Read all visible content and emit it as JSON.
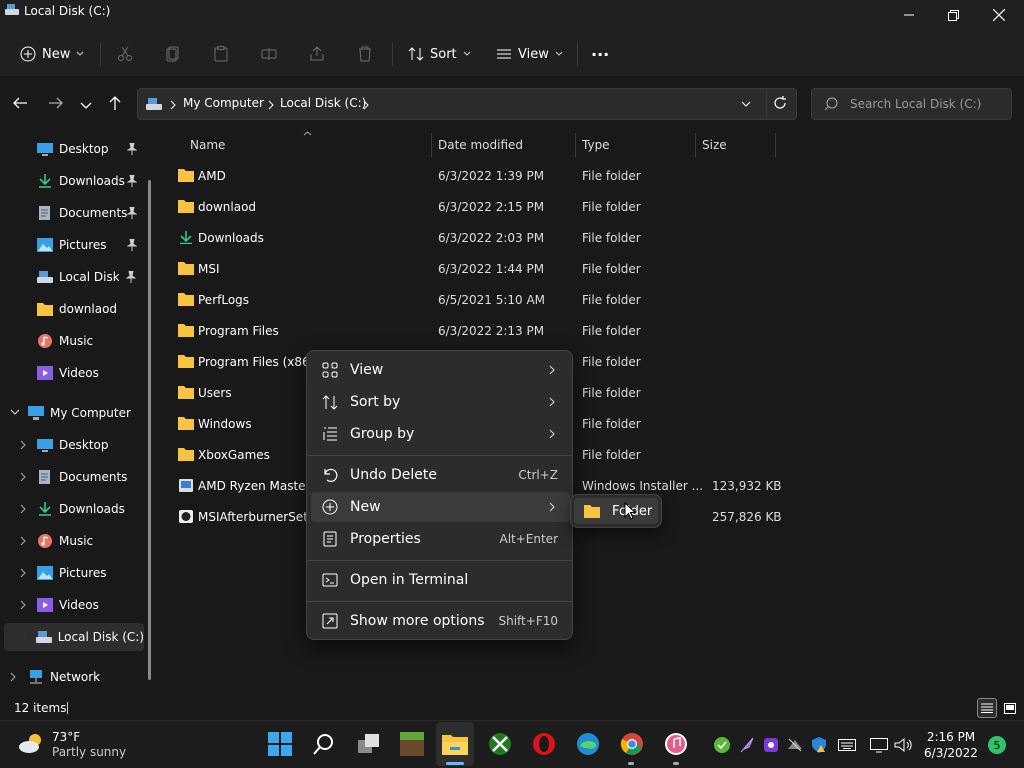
{
  "window": {
    "title": "Local Disk (C:)"
  },
  "toolbar": {
    "new_label": "New",
    "sort_label": "Sort",
    "view_label": "View",
    "more_label": "···"
  },
  "address": {
    "breadcrumb": [
      "My Computer",
      "Local Disk (C:)"
    ],
    "search_placeholder": "Search Local Disk (C:)"
  },
  "nav": {
    "quick": [
      {
        "label": "Desktop",
        "icon": "desktop-icon",
        "pinned": true
      },
      {
        "label": "Downloads",
        "icon": "download-icon",
        "pinned": true
      },
      {
        "label": "Documents",
        "icon": "document-icon",
        "pinned": true
      },
      {
        "label": "Pictures",
        "icon": "pictures-icon",
        "pinned": true
      },
      {
        "label": "Local Disk (C:)",
        "icon": "drive-icon",
        "pinned": true
      },
      {
        "label": "downlaod",
        "icon": "folder-icon",
        "pinned": false
      },
      {
        "label": "Music",
        "icon": "music-icon",
        "pinned": false
      },
      {
        "label": "Videos",
        "icon": "videos-icon",
        "pinned": false
      }
    ],
    "computer_label": "My Computer",
    "computer_children": [
      {
        "label": "Desktop",
        "icon": "desktop-icon"
      },
      {
        "label": "Documents",
        "icon": "document-icon"
      },
      {
        "label": "Downloads",
        "icon": "download-icon"
      },
      {
        "label": "Music",
        "icon": "music-icon"
      },
      {
        "label": "Pictures",
        "icon": "pictures-icon"
      },
      {
        "label": "Videos",
        "icon": "videos-icon"
      },
      {
        "label": "Local Disk (C:)",
        "icon": "drive-icon"
      }
    ],
    "network_label": "Network"
  },
  "columns": {
    "name": "Name",
    "date": "Date modified",
    "type": "Type",
    "size": "Size"
  },
  "files": [
    {
      "name": "AMD",
      "date": "6/3/2022 1:39 PM",
      "type": "File folder",
      "size": "",
      "icon": "folder-icon"
    },
    {
      "name": "downlaod",
      "date": "6/3/2022 2:15 PM",
      "type": "File folder",
      "size": "",
      "icon": "folder-icon"
    },
    {
      "name": "Downloads",
      "date": "6/3/2022 2:03 PM",
      "type": "File folder",
      "size": "",
      "icon": "download-icon"
    },
    {
      "name": "MSI",
      "date": "6/3/2022 1:44 PM",
      "type": "File folder",
      "size": "",
      "icon": "folder-icon"
    },
    {
      "name": "PerfLogs",
      "date": "6/5/2021 5:10 AM",
      "type": "File folder",
      "size": "",
      "icon": "folder-icon"
    },
    {
      "name": "Program Files",
      "date": "6/3/2022 2:13 PM",
      "type": "File folder",
      "size": "",
      "icon": "folder-icon"
    },
    {
      "name": "Program Files (x86)",
      "date": "",
      "type": "File folder",
      "size": "",
      "icon": "folder-icon"
    },
    {
      "name": "Users",
      "date": "",
      "type": "File folder",
      "size": "",
      "icon": "folder-icon"
    },
    {
      "name": "Windows",
      "date": "",
      "type": "File folder",
      "size": "",
      "icon": "folder-icon"
    },
    {
      "name": "XboxGames",
      "date": "",
      "type": "File folder",
      "size": "",
      "icon": "folder-icon"
    },
    {
      "name": "AMD Ryzen Master.m",
      "date": "",
      "type": "Windows Installer ...",
      "size": "123,932 KB",
      "icon": "installer-icon"
    },
    {
      "name": "MSIAfterburnerSetup",
      "date": "",
      "type": "",
      "size": "257,826 KB",
      "icon": "app-icon"
    }
  ],
  "status": {
    "items_count": "12 items"
  },
  "context_menu": {
    "items": [
      {
        "label": "View",
        "shortcut": "",
        "submenu": true,
        "icon": "view-grid-icon"
      },
      {
        "label": "Sort by",
        "shortcut": "",
        "submenu": true,
        "icon": "sort-icon"
      },
      {
        "label": "Group by",
        "shortcut": "",
        "submenu": true,
        "icon": "group-icon"
      },
      {
        "label": "Undo Delete",
        "shortcut": "Ctrl+Z",
        "submenu": false,
        "icon": "undo-icon"
      },
      {
        "label": "New",
        "shortcut": "",
        "submenu": true,
        "icon": "new-icon"
      },
      {
        "label": "Properties",
        "shortcut": "Alt+Enter",
        "submenu": false,
        "icon": "properties-icon"
      },
      {
        "label": "Open in Terminal",
        "shortcut": "",
        "submenu": false,
        "icon": "terminal-icon"
      },
      {
        "label": "Show more options",
        "shortcut": "Shift+F10",
        "submenu": false,
        "icon": "more-options-icon"
      }
    ],
    "submenu_new": {
      "label": "Folder"
    }
  },
  "taskbar": {
    "weather_temp": "73°F",
    "weather_desc": "Partly sunny",
    "time": "2:16 PM",
    "date": "6/3/2022",
    "badge": "5"
  },
  "colors": {
    "accent": "#ffc83d",
    "bg": "#191919",
    "menu": "#2c2c2c",
    "blue": "#0078d4"
  }
}
